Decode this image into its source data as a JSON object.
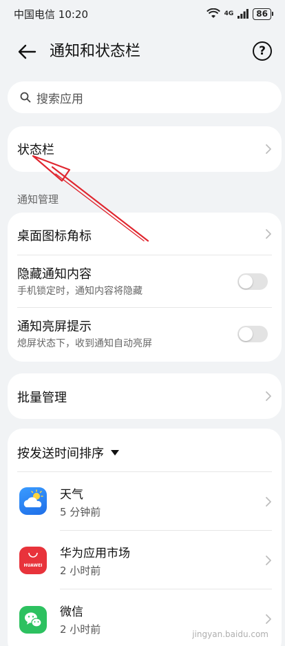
{
  "status_bar": {
    "carrier": "中国电信",
    "time": "10:20",
    "network": "4G",
    "battery": "86"
  },
  "header": {
    "title": "通知和状态栏"
  },
  "search": {
    "placeholder": "搜索应用"
  },
  "status_card": {
    "label": "状态栏"
  },
  "notification_section": {
    "title": "通知管理",
    "items": [
      {
        "label": "桌面图标角标"
      },
      {
        "label": "隐藏通知内容",
        "subtitle": "手机锁定时，通知内容将隐藏",
        "toggle_on": false
      },
      {
        "label": "通知亮屏提示",
        "subtitle": "熄屏状态下，收到通知自动亮屏",
        "toggle_on": false
      }
    ]
  },
  "batch": {
    "label": "批量管理"
  },
  "apps_section": {
    "sort_label": "按发送时间排序",
    "apps": [
      {
        "name": "天气",
        "time": "5 分钟前",
        "icon": "weather-icon"
      },
      {
        "name": "华为应用市场",
        "time": "2 小时前",
        "icon": "appgallery-icon",
        "icon_text": "HUAWEI"
      },
      {
        "name": "微信",
        "time": "2 小时前",
        "icon": "wechat-icon"
      }
    ]
  },
  "watermark": {
    "text": "jingyan.baidu.com"
  },
  "colors": {
    "background": "#f1f3f5",
    "annotation_arrow": "#e0262f",
    "weather": "#2f86f6",
    "appgallery": "#e8333b",
    "wechat": "#2dc160"
  }
}
